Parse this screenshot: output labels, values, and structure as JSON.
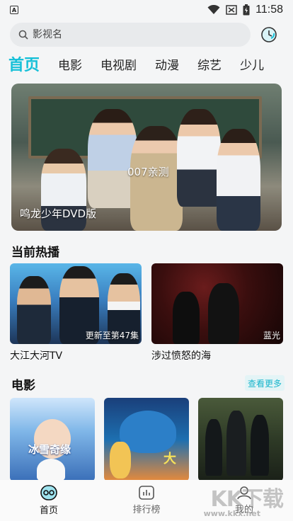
{
  "status_bar": {
    "app_badge": "A",
    "time": "11:58"
  },
  "search": {
    "placeholder": "影视名"
  },
  "tabs": [
    {
      "label": "首页",
      "active": true
    },
    {
      "label": "电影",
      "active": false
    },
    {
      "label": "电视剧",
      "active": false
    },
    {
      "label": "动漫",
      "active": false
    },
    {
      "label": "综艺",
      "active": false
    },
    {
      "label": "少儿",
      "active": false
    }
  ],
  "banner": {
    "caption": "鸣龙少年DVD版",
    "overlay_text": "007亲测"
  },
  "now_playing": {
    "title": "当前热播",
    "items": [
      {
        "title": "大江大河TV",
        "badge": "更新至第47集"
      },
      {
        "title": "涉过愤怒的海",
        "badge": "蓝光"
      }
    ]
  },
  "movies": {
    "title": "电影",
    "see_more": "查看更多",
    "poster_texts": [
      "冰雪奇缘",
      "大"
    ]
  },
  "bottom_nav": [
    {
      "label": "首页",
      "icon": "home-icon",
      "active": true
    },
    {
      "label": "排行榜",
      "icon": "ranking-icon",
      "active": false
    },
    {
      "label": "我的",
      "icon": "profile-icon",
      "active": false
    }
  ],
  "watermark": {
    "text": "KK下载",
    "sub": "www.kkx.net"
  },
  "colors": {
    "accent": "#18c0d8"
  }
}
